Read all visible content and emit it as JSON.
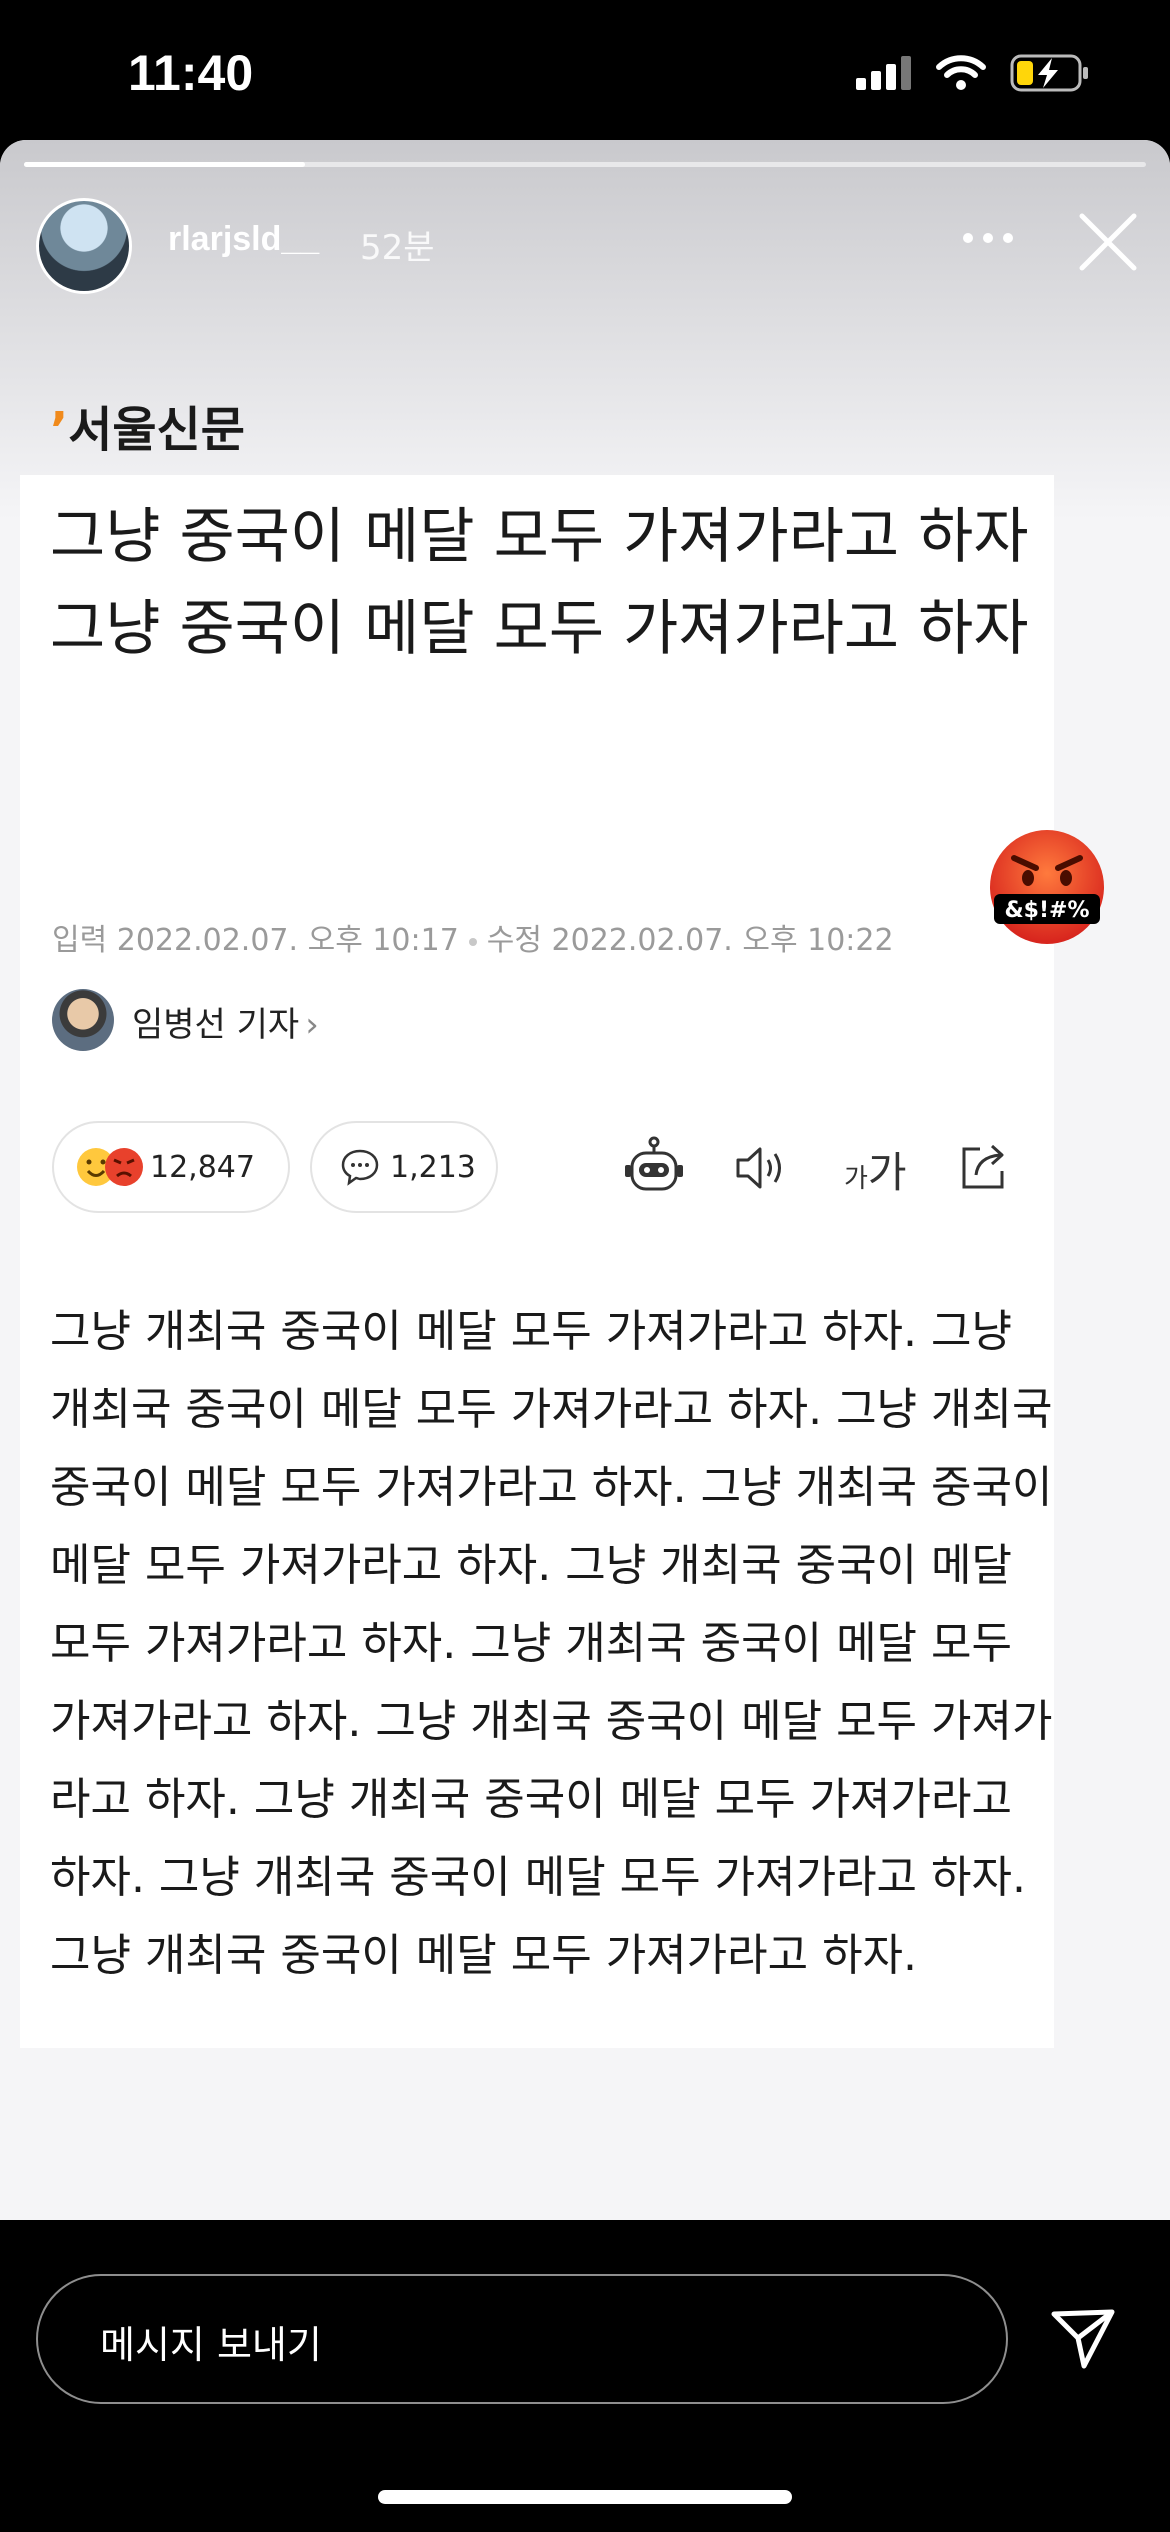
{
  "status_bar": {
    "time": "11:40"
  },
  "story_header": {
    "username": "rlarjsld__",
    "time_ago": "52분",
    "progress_fraction": 0.25
  },
  "article": {
    "publisher": "서울신문",
    "headline": "그냥 중국이 메달 모두 가져가라고 하자 그냥 중국이 메달 모두 가져가라고 하자",
    "meta": {
      "input_label": "입력",
      "input_date": "2022.02.07. 오후 10:17",
      "edit_label": "수정",
      "edit_date": "2022.02.07. 오후 10:22"
    },
    "reporter": "임병선 기자",
    "reactions_count": "12,847",
    "comments_count": "1,213",
    "font_size_label_small": "가",
    "font_size_label_large": "가",
    "body": "그냥 개최국 중국이 메달 모두 가져가라고 하자. 그냥 개최국 중국이 메달 모두 가져가라고 하자. 그냥 개최국 중국이 메달 모두 가져가라고 하자. 그냥 개최국 중국이 메달 모두 가져가라고 하자. 그냥 개최국 중국이 메달 모두 가져가라고 하자. 그냥 개최국 중국이 메달 모두 가져가라고 하자. 그냥 개최국 중국이 메달 모두 가져가라고 하자. 그냥 개최국 중국이 메달 모두 가져가라고 하자. 그냥 개최국 중국이 메달 모두 가져가라고 하자. 그냥 개최국 중국이 메달 모두 가져가라고 하자."
  },
  "sticker": {
    "text": "&$!#%",
    "icon": "cursing-face-emoji"
  },
  "reply_bar": {
    "placeholder": "메시지 보내기"
  },
  "colors": {
    "logo_accent": "#f08a1c",
    "story_bg": "#f5f5f7"
  }
}
